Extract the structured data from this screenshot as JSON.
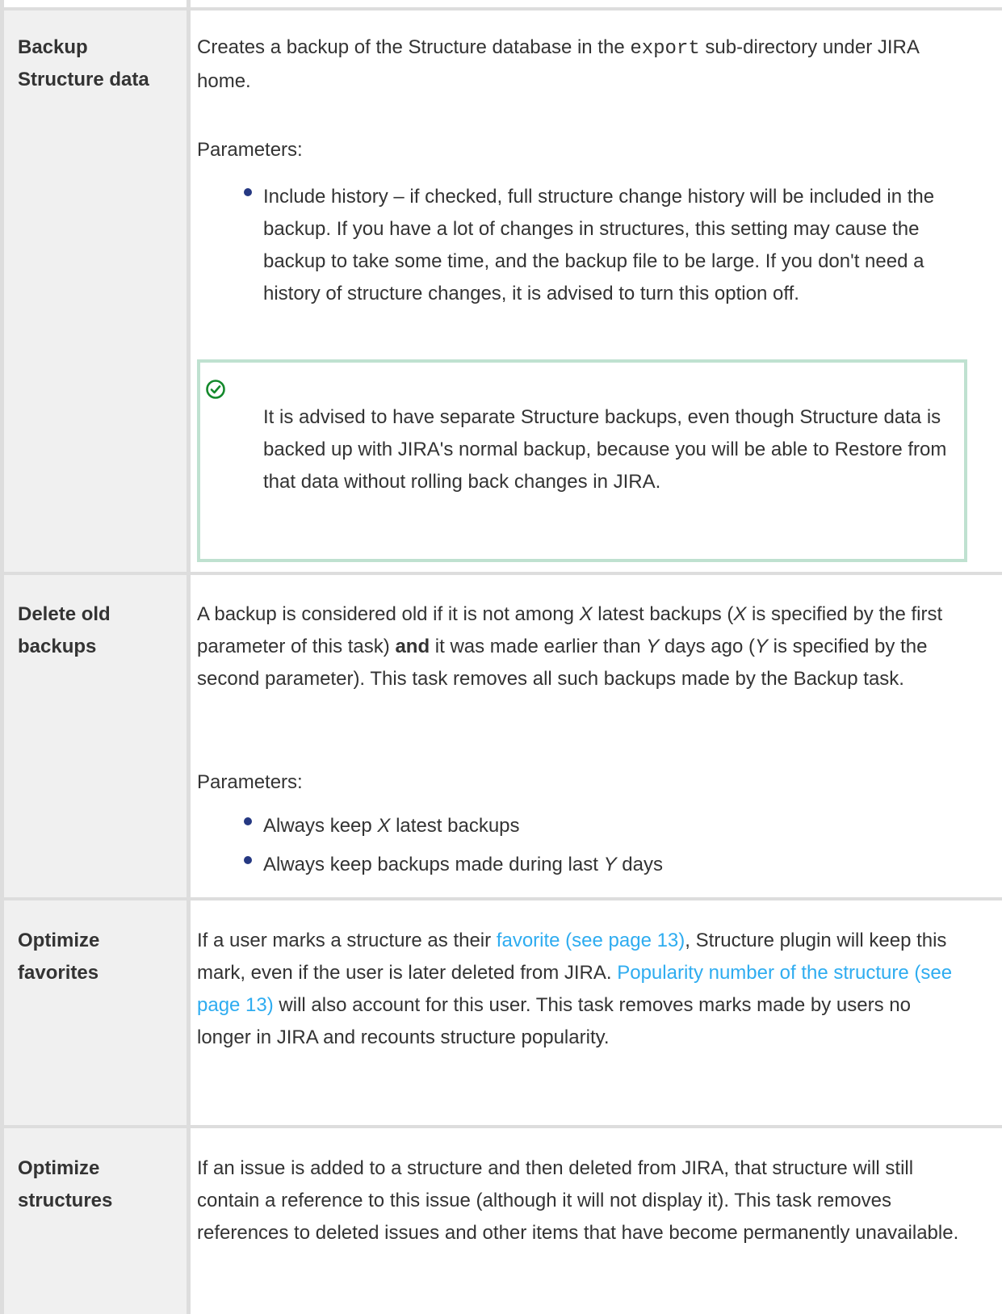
{
  "rows": [
    {
      "label": "Backup Structure data",
      "desc_before_code": "Creates a backup of the Structure database in the ",
      "code": "export",
      "desc_after_code": " sub-directory under JIRA home.",
      "params_label": "Parameters:",
      "bullets": [
        "Include history – if checked, full structure change history will be included in the backup. If you have a lot of changes in structures, this setting may cause the backup to take some time, and the backup file to be large. If you don't need a history of structure changes, it is advised to turn this option off."
      ],
      "tip": {
        "icon": "check-circle-icon",
        "text": "It is advised to have separate Structure backups, even though Structure data is backed up with JIRA's normal backup, because you will be able to Restore from that data without rolling back changes in JIRA."
      }
    },
    {
      "label": "Delete old backups",
      "desc": {
        "t1": "A backup is considered old if it is not among ",
        "x1": "X",
        "t2": " latest backups (",
        "x2": "X",
        "t3": " is specified by the first parameter of this task) ",
        "bold": "and",
        "t4": " it was made earlier than ",
        "y1": "Y",
        "t5": " days ago (",
        "y2": "Y",
        "t6": " is specified by the second parameter). This task removes all such backups made by the Backup task."
      },
      "params_label": "Parameters:",
      "bullet1": {
        "before": "Always keep ",
        "var": "X",
        "after": " latest backups"
      },
      "bullet2": {
        "before": "Always keep backups made during last ",
        "var": "Y",
        "after": " days"
      }
    },
    {
      "label": "Optimize favorites",
      "desc": {
        "t1": "If a user marks a structure as their ",
        "link1": "favorite (see page 13)",
        "t2": ", Structure plugin will keep this mark, even if the user is later deleted from JIRA. ",
        "link2": "Popularity number of the structure (see page 13)",
        "t3": " will also account for this user. This task removes marks made by users no longer in JIRA and recounts structure popularity."
      }
    },
    {
      "label": "Optimize structures",
      "desc": "If an issue is added to a structure and then deleted from JIRA, that structure will still contain a reference to this issue (although it will not display it). This task removes references to deleted issues and other items that have become permanently unavailable."
    }
  ],
  "colors": {
    "link": "#2eacf0",
    "bullet": "#253882",
    "tip_border": "#bfe1d0",
    "tip_icon": "#14892c",
    "header_bg": "#f0f0f0",
    "grid": "#dddddd"
  }
}
